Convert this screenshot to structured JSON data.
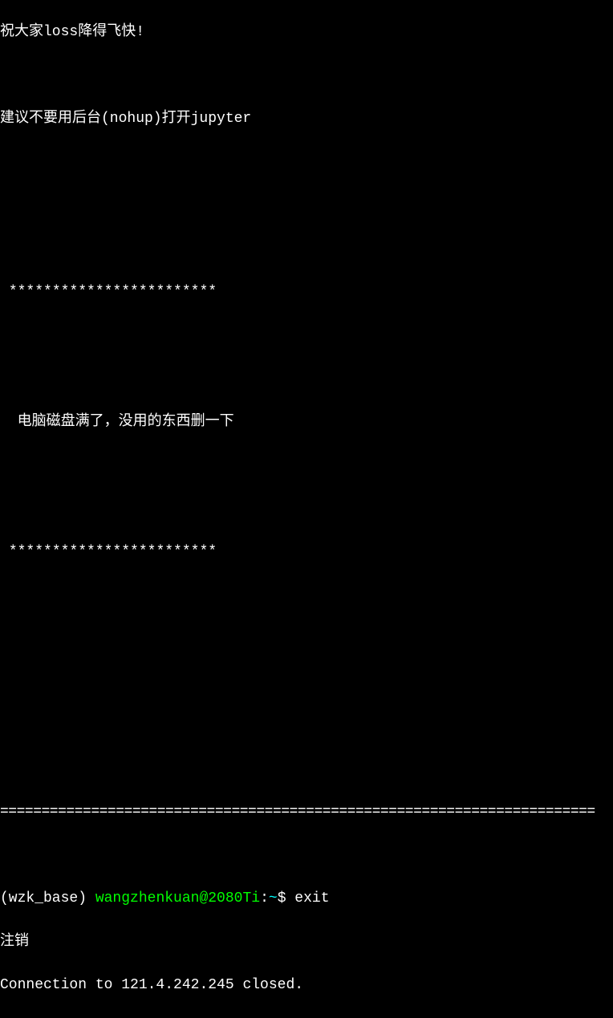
{
  "terminal": {
    "motd": {
      "line1": "祝大家loss降得飞快!",
      "line2": "建议不要用后台(nohup)打开jupyter",
      "stars1": " ************************",
      "disk_notice": "  电脑磁盘满了，没用的东西删一下",
      "stars2": " ************************"
    },
    "separator": "========================================================================",
    "prompt": {
      "env": "(wzk_base) ",
      "user_host": "wangzhenkuan@2080Ti",
      "colon": ":",
      "path": "~",
      "dollar": "$ ",
      "command": "exit"
    },
    "logout": "注销",
    "connection_closed": "Connection to 121.4.242.245 closed."
  }
}
